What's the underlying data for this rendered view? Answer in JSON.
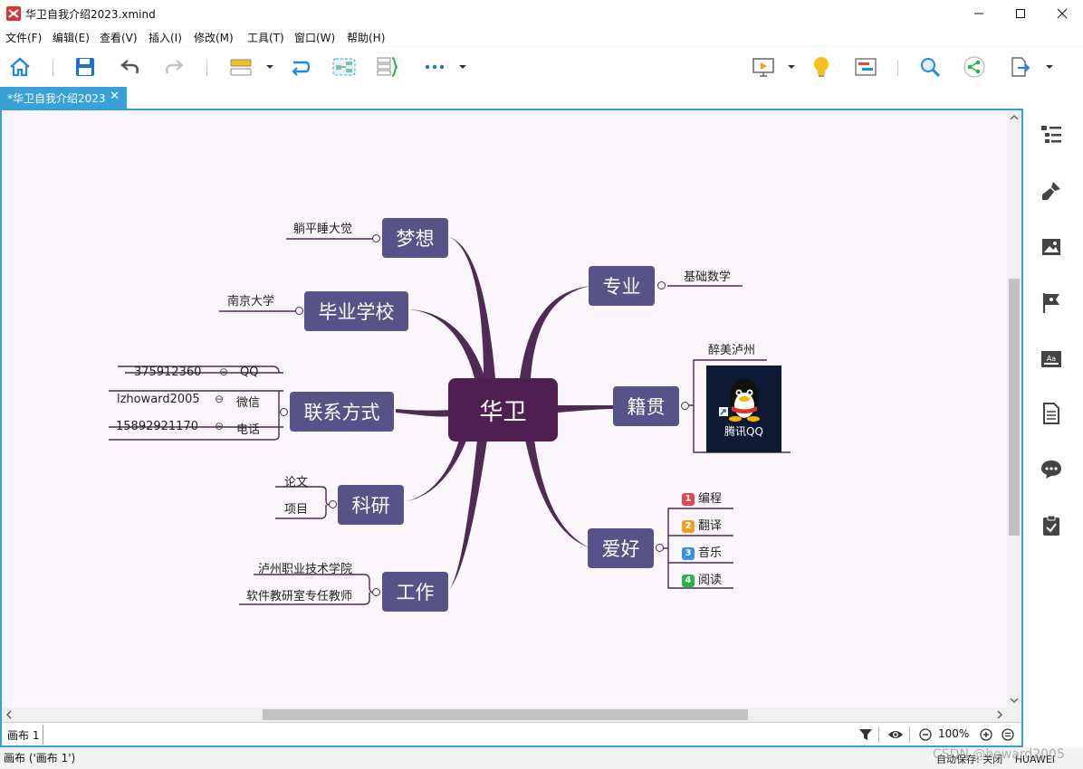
{
  "window": {
    "title": "华卫自我介绍2023.xmind"
  },
  "menu": [
    "文件(F)",
    "编辑(E)",
    "查看(V)",
    "插入(I)",
    "修改(M)",
    "工具(T)",
    "窗口(W)",
    "帮助(H)"
  ],
  "tab": {
    "label": "*华卫自我介绍2023",
    "close": "✕"
  },
  "mindmap": {
    "central": "华卫",
    "topics": {
      "dream": {
        "label": "梦想",
        "subs": [
          "躺平睡大觉"
        ]
      },
      "school": {
        "label": "毕业学校",
        "subs": [
          "南京大学"
        ]
      },
      "contact": {
        "label": "联系方式",
        "subs": [
          {
            "value": "375912360",
            "type": "QQ"
          },
          {
            "value": "lzhoward2005",
            "type": "微信"
          },
          {
            "value": "15892921170",
            "type": "电话"
          }
        ]
      },
      "research": {
        "label": "科研",
        "subs": [
          "论文",
          "项目"
        ]
      },
      "work": {
        "label": "工作",
        "subs": [
          "泸州职业技术学院",
          "软件教研室专任教师"
        ]
      },
      "major": {
        "label": "专业",
        "subs": [
          "基础数学"
        ]
      },
      "hometown": {
        "label": "籍贯",
        "subs": [
          "醉美泸州"
        ],
        "image_caption": "腾讯QQ"
      },
      "hobby": {
        "label": "爱好",
        "subs": [
          {
            "num": "1",
            "label": "编程",
            "color": "#e04a4a"
          },
          {
            "num": "2",
            "label": "翻译",
            "color": "#f0a020"
          },
          {
            "num": "3",
            "label": "音乐",
            "color": "#3a8ee6"
          },
          {
            "num": "4",
            "label": "阅读",
            "color": "#2bb24c"
          }
        ]
      }
    },
    "minus_glyph": "⊖"
  },
  "sheet": {
    "label": "画布 1"
  },
  "zoom": {
    "label": "100%"
  },
  "status": {
    "left": "画布 ('画布 1')",
    "autosave": "自动保存: 关闭",
    "brand": "HUAWEI"
  },
  "watermark": "CSDN @howard2005",
  "colors": {
    "accent": "#3aa0d8",
    "central": "#4f1f53",
    "topic": "#575288",
    "branch": "#4f2a55",
    "canvas": "#fbf6fc"
  }
}
